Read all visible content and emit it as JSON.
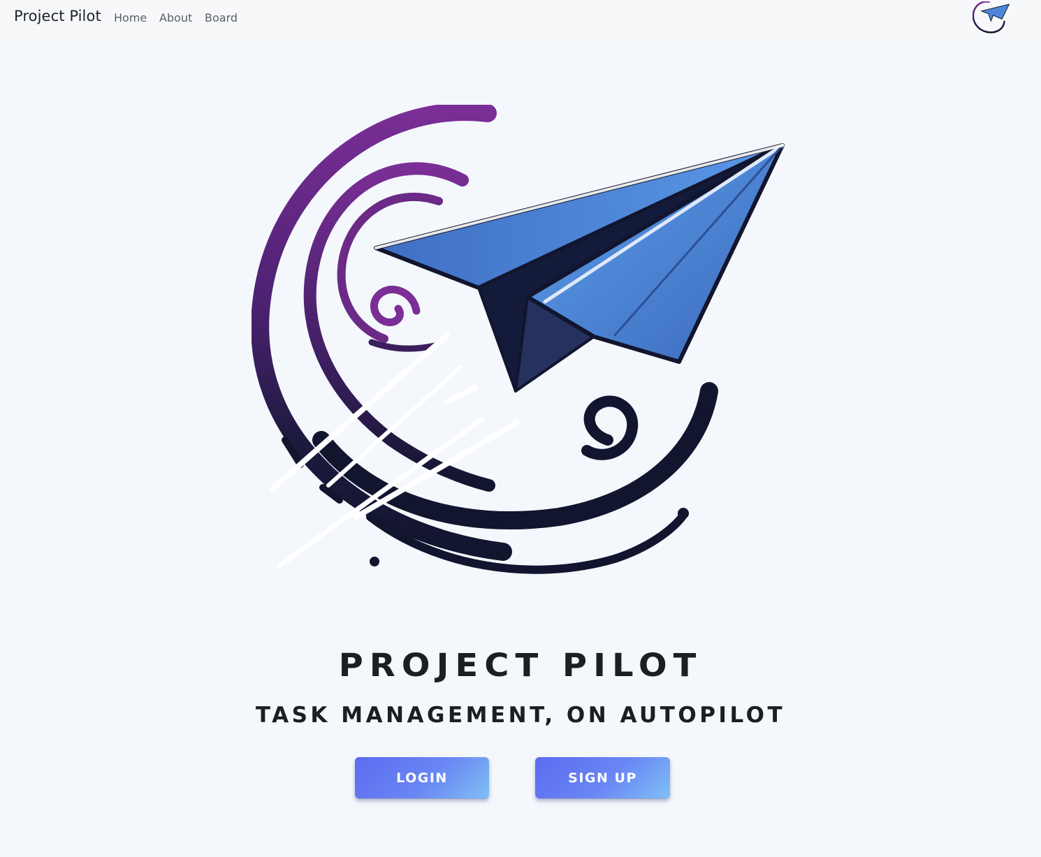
{
  "navbar": {
    "brand": "Project Pilot",
    "links": [
      "Home",
      "About",
      "Board"
    ],
    "logo_icon": "paper-plane-swirl-logo"
  },
  "hero": {
    "logo_icon": "paper-plane-swirl-logo",
    "title": "PROJECT PILOT",
    "subtitle": "TASK MANAGEMENT, ON AUTOPILOT"
  },
  "buttons": {
    "login": "LOGIN",
    "signup": "SIGN UP"
  },
  "colors": {
    "background": "#f4f7fb",
    "plane_blue": "#4f86d9",
    "swirl_purple": "#6a2a86",
    "swirl_navy": "#12152e",
    "button_start": "#5b6cf0",
    "button_end": "#7ec0f5"
  }
}
